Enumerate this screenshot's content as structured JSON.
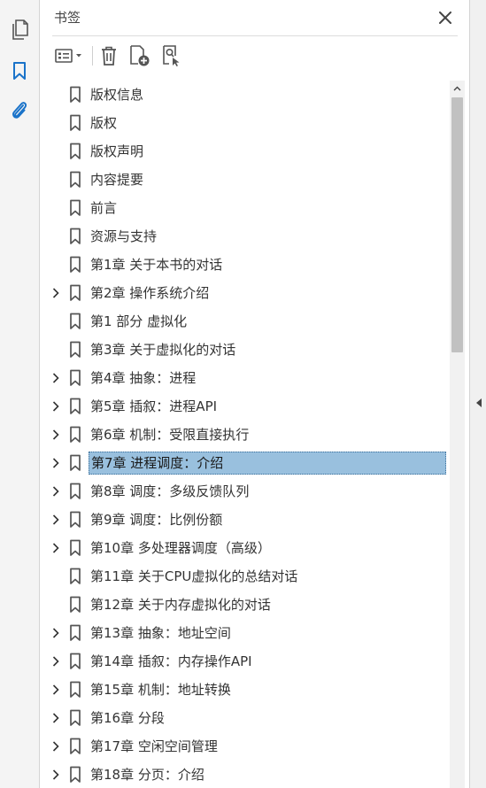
{
  "panel": {
    "title": "书签",
    "close_icon": "close-icon",
    "toolbar": {
      "options": {
        "icon": "list-options-icon"
      },
      "delete": {
        "icon": "trash-icon"
      },
      "new_bookmark": {
        "icon": "add-bookmark-icon"
      },
      "find_bookmark": {
        "icon": "find-bookmark-icon"
      }
    }
  },
  "rail": {
    "items": [
      {
        "name": "page-thumbnails",
        "icon": "pages-icon",
        "active": false
      },
      {
        "name": "bookmarks",
        "icon": "bookmark-icon",
        "active": true
      },
      {
        "name": "attachments",
        "icon": "paperclip-icon",
        "active": false
      }
    ]
  },
  "colors": {
    "accent": "#1a73c9",
    "selected_bg": "#99c0de",
    "icon_gray": "#555555"
  },
  "bookmarks": [
    {
      "label": "版权信息",
      "expandable": false,
      "selected": false
    },
    {
      "label": "版权",
      "expandable": false,
      "selected": false
    },
    {
      "label": "版权声明",
      "expandable": false,
      "selected": false
    },
    {
      "label": "内容提要",
      "expandable": false,
      "selected": false
    },
    {
      "label": "前言",
      "expandable": false,
      "selected": false
    },
    {
      "label": "资源与支持",
      "expandable": false,
      "selected": false
    },
    {
      "label": "第1章 关于本书的对话",
      "expandable": false,
      "selected": false
    },
    {
      "label": "第2章 操作系统介绍",
      "expandable": true,
      "selected": false
    },
    {
      "label": "第1 部分 虚拟化",
      "expandable": false,
      "selected": false
    },
    {
      "label": "第3章 关于虚拟化的对话",
      "expandable": false,
      "selected": false
    },
    {
      "label": "第4章 抽象：进程",
      "expandable": true,
      "selected": false
    },
    {
      "label": "第5章 插叙：进程API",
      "expandable": true,
      "selected": false
    },
    {
      "label": "第6章 机制：受限直接执行",
      "expandable": true,
      "selected": false
    },
    {
      "label": "第7章 进程调度：介绍",
      "expandable": true,
      "selected": true
    },
    {
      "label": "第8章 调度：多级反馈队列",
      "expandable": true,
      "selected": false
    },
    {
      "label": "第9章 调度：比例份额",
      "expandable": true,
      "selected": false
    },
    {
      "label": "第10章 多处理器调度（高级）",
      "expandable": true,
      "selected": false
    },
    {
      "label": "第11章 关于CPU虚拟化的总结对话",
      "expandable": false,
      "selected": false
    },
    {
      "label": "第12章 关于内存虚拟化的对话",
      "expandable": false,
      "selected": false
    },
    {
      "label": "第13章 抽象：地址空间",
      "expandable": true,
      "selected": false
    },
    {
      "label": "第14章 插叙：内存操作API",
      "expandable": true,
      "selected": false
    },
    {
      "label": "第15章 机制：地址转换",
      "expandable": true,
      "selected": false
    },
    {
      "label": "第16章 分段",
      "expandable": true,
      "selected": false
    },
    {
      "label": "第17章 空闲空间管理",
      "expandable": true,
      "selected": false
    },
    {
      "label": "第18章 分页：介绍",
      "expandable": true,
      "selected": false
    }
  ],
  "scrollbar": {
    "position_fraction": 0.0,
    "visible_fraction": 0.37
  }
}
